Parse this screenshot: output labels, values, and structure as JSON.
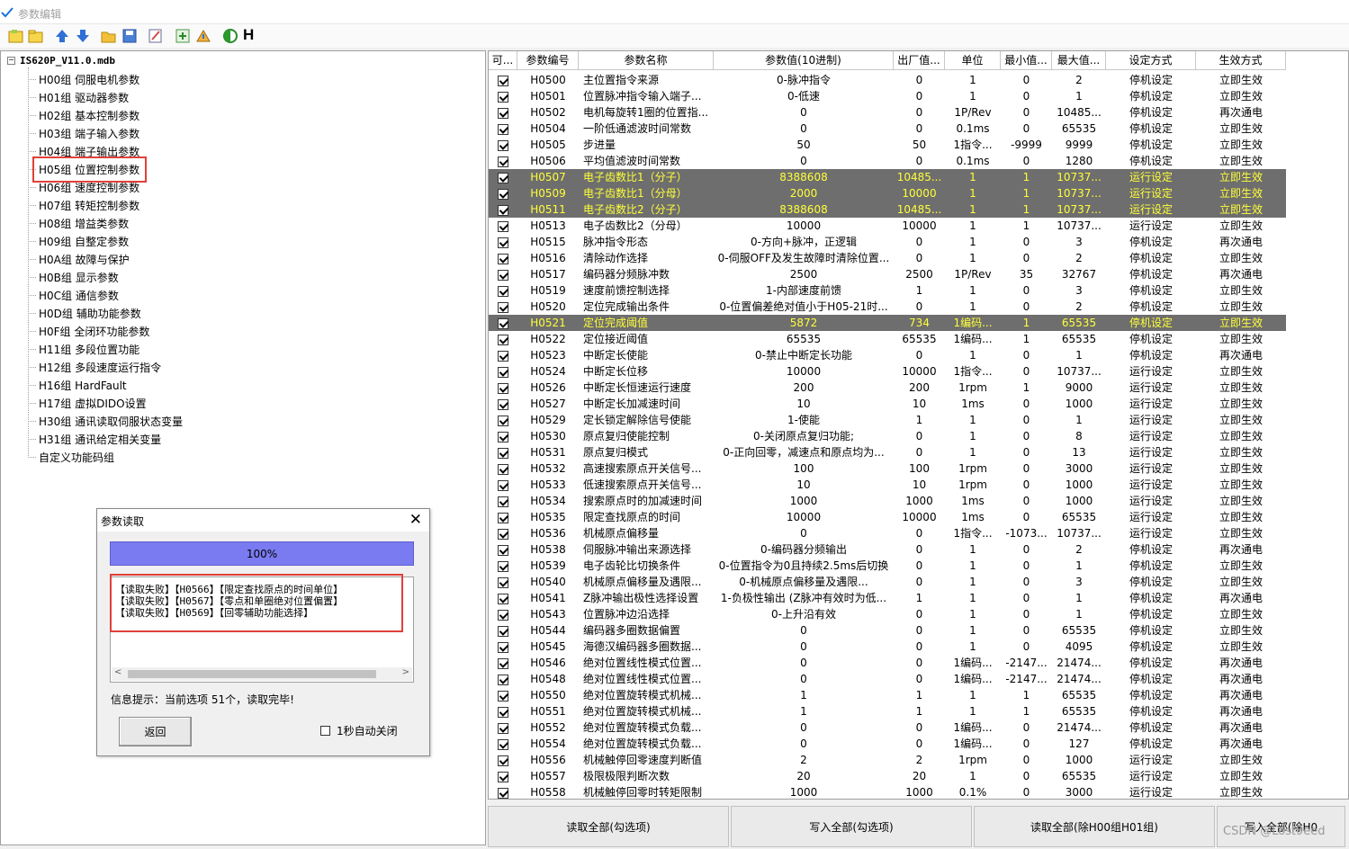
{
  "window": {
    "title": "参数编辑"
  },
  "toolbar": {
    "h_label": "H"
  },
  "tree": {
    "root": "IS620P_V11.0.mdb",
    "groups": [
      "H00组 伺服电机参数",
      "H01组 驱动器参数",
      "H02组 基本控制参数",
      "H03组 端子输入参数",
      "H04组 端子输出参数",
      "H05组 位置控制参数",
      "H06组 速度控制参数",
      "H07组 转矩控制参数",
      "H08组 增益类参数",
      "H09组 自整定参数",
      "H0A组 故障与保护",
      "H0B组 显示参数",
      "H0C组 通信参数",
      "H0D组 辅助功能参数",
      "H0F组 全闭环功能参数",
      "H11组 多段位置功能",
      "H12组 多段速度运行指令",
      "H16组 HardFault",
      "H17组 虚拟DIDO设置",
      "H30组 通讯读取伺服状态变量",
      "H31组 通讯给定相关变量",
      "自定义功能码组"
    ]
  },
  "grid": {
    "headers": [
      "可...",
      "参数编号",
      "参数名称",
      "参数值(10进制)",
      "出厂值...",
      "单位",
      "最小值...",
      "最大值...",
      "设定方式",
      "生效方式"
    ],
    "rows": [
      [
        "H0500",
        "主位置指令来源",
        "0-脉冲指令",
        "0",
        "1",
        "0",
        "2",
        "停机设定",
        "立即生效"
      ],
      [
        "H0501",
        "位置脉冲指令输入端子...",
        "0-低速",
        "0",
        "1",
        "0",
        "1",
        "停机设定",
        "立即生效"
      ],
      [
        "H0502",
        "电机每旋转1圈的位置指...",
        "0",
        "0",
        "1P/Rev",
        "0",
        "10485...",
        "停机设定",
        "再次通电"
      ],
      [
        "H0504",
        "一阶低通滤波时间常数",
        "0",
        "0",
        "0.1ms",
        "0",
        "65535",
        "停机设定",
        "立即生效"
      ],
      [
        "H0505",
        "步进量",
        "50",
        "50",
        "1指令...",
        "-9999",
        "9999",
        "停机设定",
        "立即生效"
      ],
      [
        "H0506",
        "平均值滤波时间常数",
        "0",
        "0",
        "0.1ms",
        "0",
        "1280",
        "停机设定",
        "立即生效"
      ],
      [
        "H0507",
        "电子齿数比1（分子）",
        "8388608",
        "10485...",
        "1",
        "1",
        "10737...",
        "运行设定",
        "立即生效"
      ],
      [
        "H0509",
        "电子齿数比1（分母）",
        "2000",
        "10000",
        "1",
        "1",
        "10737...",
        "运行设定",
        "立即生效"
      ],
      [
        "H0511",
        "电子齿数比2（分子）",
        "8388608",
        "10485...",
        "1",
        "1",
        "10737...",
        "运行设定",
        "立即生效"
      ],
      [
        "H0513",
        "电子齿数比2（分母）",
        "10000",
        "10000",
        "1",
        "1",
        "10737...",
        "运行设定",
        "立即生效"
      ],
      [
        "H0515",
        "脉冲指令形态",
        "0-方向+脉冲，正逻辑",
        "0",
        "1",
        "0",
        "3",
        "停机设定",
        "再次通电"
      ],
      [
        "H0516",
        "清除动作选择",
        "0-伺服OFF及发生故障时清除位置...",
        "0",
        "1",
        "0",
        "2",
        "停机设定",
        "立即生效"
      ],
      [
        "H0517",
        "编码器分频脉冲数",
        "2500",
        "2500",
        "1P/Rev",
        "35",
        "32767",
        "停机设定",
        "再次通电"
      ],
      [
        "H0519",
        "速度前馈控制选择",
        "1-内部速度前馈",
        "1",
        "1",
        "0",
        "3",
        "停机设定",
        "立即生效"
      ],
      [
        "H0520",
        "定位完成输出条件",
        "0-位置偏差绝对值小于H05-21时...",
        "0",
        "1",
        "0",
        "2",
        "停机设定",
        "立即生效"
      ],
      [
        "H0521",
        "定位完成阈值",
        "5872",
        "734",
        "1编码...",
        "1",
        "65535",
        "停机设定",
        "立即生效"
      ],
      [
        "H0522",
        "定位接近阈值",
        "65535",
        "65535",
        "1编码...",
        "1",
        "65535",
        "停机设定",
        "立即生效"
      ],
      [
        "H0523",
        "中断定长使能",
        "0-禁止中断定长功能",
        "0",
        "1",
        "0",
        "1",
        "停机设定",
        "再次通电"
      ],
      [
        "H0524",
        "中断定长位移",
        "10000",
        "10000",
        "1指令...",
        "0",
        "10737...",
        "运行设定",
        "立即生效"
      ],
      [
        "H0526",
        "中断定长恒速运行速度",
        "200",
        "200",
        "1rpm",
        "1",
        "9000",
        "运行设定",
        "立即生效"
      ],
      [
        "H0527",
        "中断定长加减速时间",
        "10",
        "10",
        "1ms",
        "0",
        "1000",
        "运行设定",
        "立即生效"
      ],
      [
        "H0529",
        "定长锁定解除信号使能",
        "1-使能",
        "1",
        "1",
        "0",
        "1",
        "运行设定",
        "立即生效"
      ],
      [
        "H0530",
        "原点复归使能控制",
        "0-关闭原点复归功能;",
        "0",
        "1",
        "0",
        "8",
        "运行设定",
        "立即生效"
      ],
      [
        "H0531",
        "原点复归模式",
        "0-正向回零，减速点和原点均为...",
        "0",
        "1",
        "0",
        "13",
        "运行设定",
        "立即生效"
      ],
      [
        "H0532",
        "高速搜索原点开关信号...",
        "100",
        "100",
        "1rpm",
        "0",
        "3000",
        "运行设定",
        "立即生效"
      ],
      [
        "H0533",
        "低速搜索原点开关信号...",
        "10",
        "10",
        "1rpm",
        "0",
        "1000",
        "运行设定",
        "立即生效"
      ],
      [
        "H0534",
        "搜索原点时的加减速时间",
        "1000",
        "1000",
        "1ms",
        "0",
        "1000",
        "运行设定",
        "立即生效"
      ],
      [
        "H0535",
        "限定查找原点的时间",
        "10000",
        "10000",
        "1ms",
        "0",
        "65535",
        "运行设定",
        "立即生效"
      ],
      [
        "H0536",
        "机械原点偏移量",
        "0",
        "0",
        "1指令...",
        "-1073...",
        "10737...",
        "运行设定",
        "立即生效"
      ],
      [
        "H0538",
        "伺服脉冲输出来源选择",
        "0-编码器分频输出",
        "0",
        "1",
        "0",
        "2",
        "停机设定",
        "再次通电"
      ],
      [
        "H0539",
        "电子齿轮比切换条件",
        "0-位置指令为0且持续2.5ms后切换",
        "0",
        "1",
        "0",
        "1",
        "停机设定",
        "立即生效"
      ],
      [
        "H0540",
        "机械原点偏移量及遇限...",
        "0-机械原点偏移量及遇限...",
        "0",
        "1",
        "0",
        "3",
        "停机设定",
        "立即生效"
      ],
      [
        "H0541",
        "Z脉冲输出极性选择设置",
        "1-负极性输出 (Z脉冲有效时为低...",
        "1",
        "1",
        "0",
        "1",
        "停机设定",
        "再次通电"
      ],
      [
        "H0543",
        "位置脉冲边沿选择",
        "0-上升沿有效",
        "0",
        "1",
        "0",
        "1",
        "停机设定",
        "立即生效"
      ],
      [
        "H0544",
        "编码器多圈数据偏置",
        "0",
        "0",
        "1",
        "0",
        "65535",
        "停机设定",
        "立即生效"
      ],
      [
        "H0545",
        "海德汉编码器多圈数据...",
        "0",
        "0",
        "1",
        "0",
        "4095",
        "停机设定",
        "立即生效"
      ],
      [
        "H0546",
        "绝对位置线性模式位置...",
        "0",
        "0",
        "1编码...",
        "-2147...",
        "21474...",
        "停机设定",
        "再次通电"
      ],
      [
        "H0548",
        "绝对位置线性模式位置...",
        "0",
        "0",
        "1编码...",
        "-2147...",
        "21474...",
        "停机设定",
        "再次通电"
      ],
      [
        "H0550",
        "绝对位置旋转模式机械...",
        "1",
        "1",
        "1",
        "1",
        "65535",
        "停机设定",
        "再次通电"
      ],
      [
        "H0551",
        "绝对位置旋转模式机械...",
        "1",
        "1",
        "1",
        "1",
        "65535",
        "停机设定",
        "再次通电"
      ],
      [
        "H0552",
        "绝对位置旋转模式负载...",
        "0",
        "0",
        "1编码...",
        "0",
        "21474...",
        "停机设定",
        "再次通电"
      ],
      [
        "H0554",
        "绝对位置旋转模式负载...",
        "0",
        "0",
        "1编码...",
        "0",
        "127",
        "停机设定",
        "再次通电"
      ],
      [
        "H0556",
        "机械触停回零速度判断值",
        "2",
        "2",
        "1rpm",
        "0",
        "1000",
        "运行设定",
        "立即生效"
      ],
      [
        "H0557",
        "极限极限判断次数",
        "20",
        "20",
        "1",
        "0",
        "65535",
        "运行设定",
        "立即生效"
      ],
      [
        "H0558",
        "机械触停回零时转矩限制",
        "1000",
        "1000",
        "0.1%",
        "0",
        "3000",
        "运行设定",
        "立即生效"
      ]
    ],
    "highlighted": [
      "H0507",
      "H0509",
      "H0511",
      "H0521"
    ]
  },
  "buttons": {
    "read_all_checked": "读取全部(勾选项)",
    "write_all_checked": "写入全部(勾选项)",
    "read_all_except": "读取全部(除H00组H01组)",
    "write_all_except": "写入全部(除H0"
  },
  "watermark": "CSDN @Lost9eed",
  "dialog": {
    "title": "参数读取",
    "progress": {
      "label": "100%",
      "value": 100
    },
    "log": [
      "【读取失败】【H0566】【限定查找原点的时间单位】",
      "【读取失败】【H0567】【零点和单圈绝对位置偏置】",
      "【读取失败】【H0569】【回零辅助功能选择】"
    ],
    "info": "信息提示：当前选项 51个，读取完毕!",
    "back_label": "返回",
    "auto_close_label": "1秒自动关闭"
  }
}
